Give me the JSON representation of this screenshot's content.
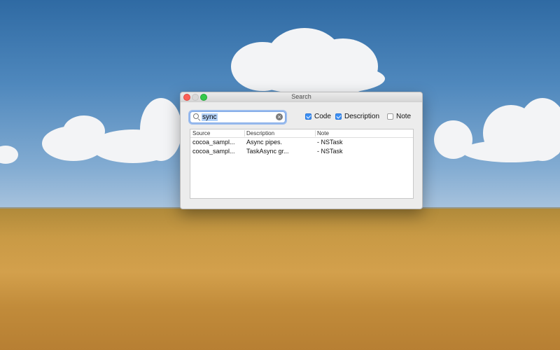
{
  "window": {
    "title": "Search"
  },
  "search": {
    "value": "sync",
    "clear_glyph": "×"
  },
  "options": {
    "code": {
      "label": "Code",
      "checked": true
    },
    "description": {
      "label": "Description",
      "checked": true
    },
    "note": {
      "label": "Note",
      "checked": false
    }
  },
  "table": {
    "columns": [
      "Source",
      "Description",
      "Note"
    ],
    "rows": [
      {
        "source": "cocoa_sampl...",
        "description": "Async pipes.",
        "note": "- NSTask"
      },
      {
        "source": "cocoa_sampl...",
        "description": "TaskAsync gr...",
        "note": "- NSTask"
      }
    ]
  },
  "colors": {
    "accent": "#3b8ff5",
    "close": "#fc5f57",
    "maximize": "#35c94a"
  }
}
